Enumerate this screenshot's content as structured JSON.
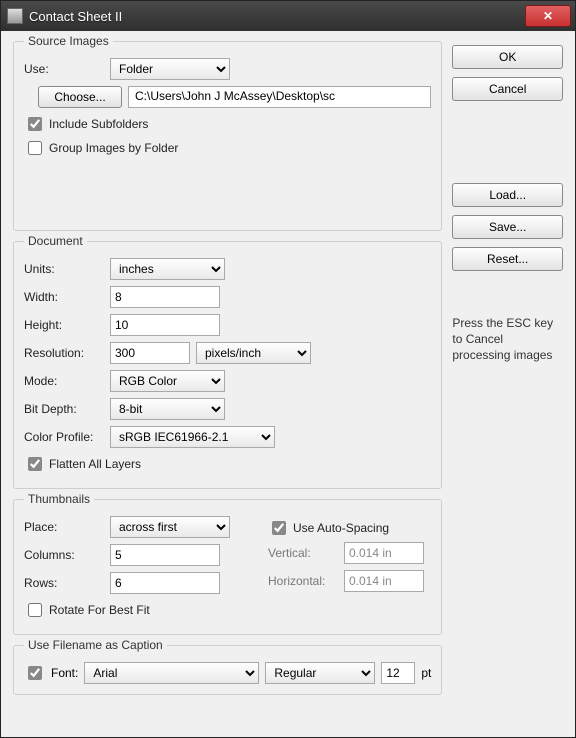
{
  "window": {
    "title": "Contact Sheet II"
  },
  "buttons": {
    "ok": "OK",
    "cancel": "Cancel",
    "load": "Load...",
    "save": "Save...",
    "reset": "Reset..."
  },
  "hint": "Press the ESC key to Cancel processing images",
  "source": {
    "legend": "Source Images",
    "use_label": "Use:",
    "use_value": "Folder",
    "choose": "Choose...",
    "path": "C:\\Users\\John J McAssey\\Desktop\\sc",
    "include_sub": "Include Subfolders",
    "group_folder": "Group Images by Folder"
  },
  "document": {
    "legend": "Document",
    "units_label": "Units:",
    "units_value": "inches",
    "width_label": "Width:",
    "width_value": "8",
    "height_label": "Height:",
    "height_value": "10",
    "resolution_label": "Resolution:",
    "resolution_value": "300",
    "resolution_unit": "pixels/inch",
    "mode_label": "Mode:",
    "mode_value": "RGB Color",
    "bitdepth_label": "Bit Depth:",
    "bitdepth_value": "8-bit",
    "colorprofile_label": "Color Profile:",
    "colorprofile_value": "sRGB IEC61966-2.1",
    "flatten": "Flatten All Layers"
  },
  "thumbnails": {
    "legend": "Thumbnails",
    "place_label": "Place:",
    "place_value": "across first",
    "columns_label": "Columns:",
    "columns_value": "5",
    "rows_label": "Rows:",
    "rows_value": "6",
    "rotate": "Rotate For Best Fit",
    "autospacing": "Use Auto-Spacing",
    "vertical_label": "Vertical:",
    "vertical_value": "0.014 in",
    "horizontal_label": "Horizontal:",
    "horizontal_value": "0.014 in"
  },
  "caption": {
    "legend": "Use Filename as Caption",
    "font_label": "Font:",
    "font_name": "Arial",
    "font_style": "Regular",
    "font_size": "12",
    "pt": "pt"
  }
}
